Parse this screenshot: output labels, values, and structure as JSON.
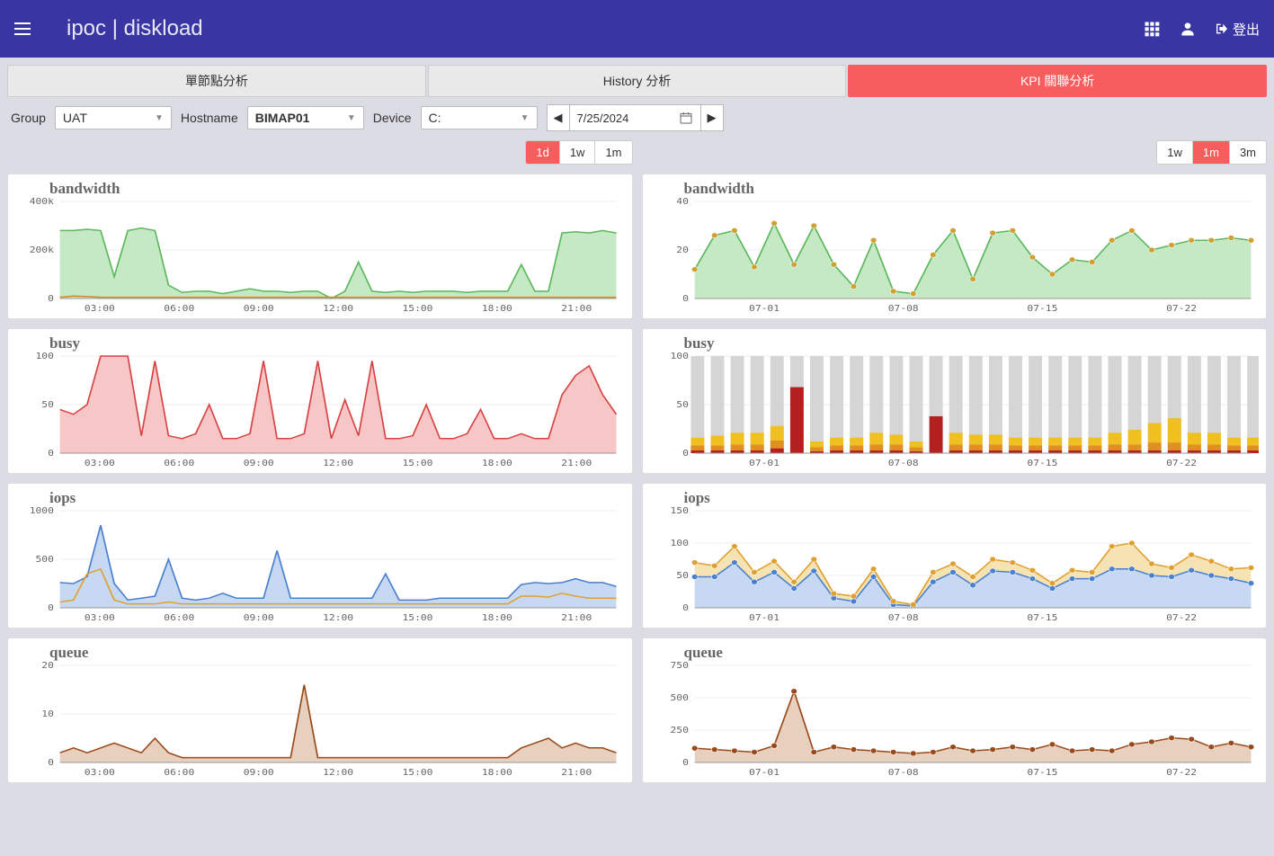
{
  "header": {
    "title": "ipoc  |  diskload",
    "logout_label": "登出"
  },
  "tabs": [
    {
      "label": "單節點分析",
      "active": false
    },
    {
      "label": "History 分析",
      "active": false
    },
    {
      "label": "KPI 關聯分析",
      "active": true
    }
  ],
  "filters": {
    "group_label": "Group",
    "group_value": "UAT",
    "hostname_label": "Hostname",
    "hostname_value": "BIMAP01",
    "device_label": "Device",
    "device_value": "C:",
    "date_value": "7/25/2024"
  },
  "left_ranges": [
    {
      "label": "1d",
      "active": true
    },
    {
      "label": "1w",
      "active": false
    },
    {
      "label": "1m",
      "active": false
    }
  ],
  "right_ranges": [
    {
      "label": "1w",
      "active": false
    },
    {
      "label": "1m",
      "active": true
    },
    {
      "label": "3m",
      "active": false
    }
  ],
  "chart_data": {
    "left": {
      "x_ticks": [
        "03:00",
        "06:00",
        "09:00",
        "12:00",
        "15:00",
        "18:00",
        "21:00"
      ],
      "bandwidth": {
        "title": "bandwidth",
        "y_ticks": [
          "0",
          "200k",
          "400k"
        ],
        "ylim": [
          0,
          400
        ],
        "color": "#5bb85b",
        "fill": "#c5e8c5",
        "values_high": [
          280,
          280,
          285,
          280,
          90,
          280,
          290,
          280,
          55,
          25,
          30,
          30,
          20,
          30,
          40,
          30,
          30,
          25,
          30,
          30,
          0,
          30,
          150,
          30,
          25,
          30,
          25,
          30,
          30,
          30,
          25,
          30,
          30,
          30,
          140,
          30,
          30,
          270,
          275,
          270,
          280,
          270
        ],
        "values_low": [
          5,
          10,
          8,
          5,
          5,
          5,
          5,
          5,
          5,
          5,
          5,
          5,
          5,
          5,
          5,
          5,
          5,
          5,
          5,
          5,
          5,
          5,
          5,
          5,
          5,
          5,
          5,
          5,
          5,
          5,
          5,
          5,
          5,
          5,
          5,
          5,
          5,
          5,
          5,
          5,
          5,
          5
        ],
        "color2": "#d08a2a"
      },
      "busy": {
        "title": "busy",
        "y_ticks": [
          "0",
          "50",
          "100"
        ],
        "ylim": [
          0,
          100
        ],
        "color": "#d84444",
        "fill": "#f7c6c6",
        "values": [
          45,
          40,
          50,
          100,
          100,
          100,
          18,
          95,
          18,
          15,
          20,
          50,
          15,
          15,
          20,
          95,
          15,
          15,
          20,
          95,
          15,
          55,
          18,
          95,
          15,
          15,
          18,
          50,
          15,
          15,
          20,
          45,
          15,
          15,
          20,
          15,
          15,
          60,
          80,
          90,
          60,
          40
        ]
      },
      "iops": {
        "title": "iops",
        "y_ticks": [
          "0",
          "500",
          "1000"
        ],
        "ylim": [
          0,
          1000
        ],
        "color": "#4a80d0",
        "fill": "#c6d8f2",
        "color2": "#e0a030",
        "fill2": "#f6e3b4",
        "values": [
          260,
          250,
          320,
          850,
          250,
          80,
          100,
          120,
          500,
          100,
          80,
          100,
          150,
          100,
          100,
          100,
          590,
          100,
          100,
          100,
          100,
          100,
          100,
          100,
          350,
          80,
          80,
          80,
          100,
          100,
          100,
          100,
          100,
          100,
          240,
          260,
          250,
          260,
          300,
          260,
          260,
          220
        ],
        "values2": [
          60,
          80,
          350,
          400,
          80,
          40,
          40,
          40,
          60,
          40,
          40,
          40,
          40,
          40,
          40,
          40,
          40,
          40,
          40,
          40,
          40,
          40,
          40,
          40,
          40,
          40,
          40,
          40,
          40,
          40,
          40,
          40,
          40,
          40,
          120,
          120,
          110,
          150,
          120,
          100,
          100,
          100
        ]
      },
      "queue": {
        "title": "queue",
        "y_ticks": [
          "0",
          "10",
          "20"
        ],
        "ylim": [
          0,
          20
        ],
        "color": "#9a4a1a",
        "fill": "#e8d0be",
        "values": [
          2,
          3,
          2,
          3,
          4,
          3,
          2,
          5,
          2,
          1,
          1,
          1,
          1,
          1,
          1,
          1,
          1,
          1,
          16,
          1,
          1,
          1,
          1,
          1,
          1,
          1,
          1,
          1,
          1,
          1,
          1,
          1,
          1,
          1,
          3,
          4,
          5,
          3,
          4,
          3,
          3,
          2
        ]
      }
    },
    "right": {
      "x_ticks": [
        "07-01",
        "07-08",
        "07-15",
        "07-22"
      ],
      "bandwidth": {
        "title": "bandwidth",
        "y_ticks": [
          "0",
          "20",
          "40"
        ],
        "ylim": [
          0,
          40
        ],
        "color": "#5bb85b",
        "fill": "#c5e8c5",
        "marker": "#d0a030",
        "values": [
          12,
          26,
          28,
          13,
          31,
          14,
          30,
          14,
          5,
          24,
          3,
          2,
          18,
          28,
          8,
          27,
          28,
          17,
          10,
          16,
          15,
          24,
          28,
          20,
          22,
          24,
          24,
          25,
          24
        ]
      },
      "busy": {
        "title": "busy",
        "y_ticks": [
          "0",
          "50",
          "100"
        ],
        "ylim": [
          0,
          100
        ],
        "bg_color": "#d5d5d5",
        "colors": [
          "#b32020",
          "#e09020",
          "#f0c020"
        ],
        "stacks": [
          [
            3,
            5,
            8
          ],
          [
            3,
            5,
            10
          ],
          [
            3,
            6,
            12
          ],
          [
            3,
            6,
            12
          ],
          [
            5,
            8,
            15
          ],
          [
            68,
            0,
            0
          ],
          [
            2,
            4,
            6
          ],
          [
            3,
            5,
            8
          ],
          [
            3,
            5,
            8
          ],
          [
            3,
            6,
            12
          ],
          [
            3,
            6,
            10
          ],
          [
            2,
            4,
            6
          ],
          [
            38,
            0,
            0
          ],
          [
            3,
            6,
            12
          ],
          [
            3,
            6,
            10
          ],
          [
            3,
            6,
            10
          ],
          [
            3,
            5,
            8
          ],
          [
            3,
            5,
            8
          ],
          [
            3,
            5,
            8
          ],
          [
            3,
            5,
            8
          ],
          [
            3,
            5,
            8
          ],
          [
            3,
            6,
            12
          ],
          [
            3,
            6,
            15
          ],
          [
            3,
            8,
            20
          ],
          [
            3,
            8,
            25
          ],
          [
            3,
            6,
            12
          ],
          [
            3,
            6,
            12
          ],
          [
            3,
            5,
            8
          ],
          [
            3,
            5,
            8
          ]
        ]
      },
      "iops": {
        "title": "iops",
        "y_ticks": [
          "0",
          "50",
          "100",
          "150"
        ],
        "ylim": [
          0,
          150
        ],
        "color": "#4a80d0",
        "fill": "#c6d8f2",
        "color2": "#e0a030",
        "fill2": "#f6e3b4",
        "values": [
          48,
          48,
          70,
          40,
          55,
          30,
          57,
          15,
          10,
          48,
          5,
          3,
          40,
          55,
          35,
          57,
          55,
          45,
          30,
          45,
          45,
          60,
          60,
          50,
          48,
          58,
          50,
          45,
          38
        ],
        "values2": [
          70,
          65,
          95,
          55,
          72,
          40,
          75,
          22,
          18,
          60,
          10,
          5,
          55,
          68,
          48,
          75,
          70,
          58,
          38,
          58,
          55,
          95,
          100,
          68,
          62,
          82,
          72,
          60,
          62
        ]
      },
      "queue": {
        "title": "queue",
        "y_ticks": [
          "0",
          "250",
          "500",
          "750"
        ],
        "ylim": [
          0,
          750
        ],
        "color": "#9a4a1a",
        "fill": "#e8d0be",
        "marker": "#9a4a1a",
        "values": [
          110,
          100,
          90,
          80,
          130,
          550,
          80,
          120,
          100,
          90,
          80,
          70,
          80,
          120,
          90,
          100,
          120,
          100,
          140,
          90,
          100,
          90,
          140,
          160,
          190,
          180,
          120,
          150,
          120
        ]
      }
    }
  }
}
